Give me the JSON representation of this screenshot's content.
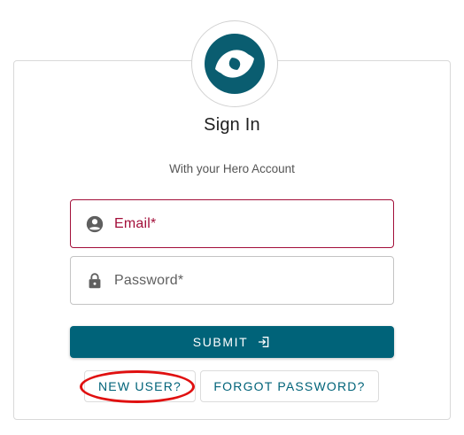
{
  "header": {
    "title": "Sign In",
    "subtitle": "With your Hero Account",
    "logo_icon": "hero-swirl-logo",
    "brand_color": "#0a5d70"
  },
  "form": {
    "email": {
      "label": "Email*",
      "icon": "account-circle-icon",
      "state": "error",
      "value": ""
    },
    "password": {
      "label": "Password*",
      "icon": "lock-icon",
      "value": ""
    },
    "submit_label": "SUBMIT",
    "submit_icon": "login-icon",
    "primary_color": "#006379",
    "error_color": "#a30f3a"
  },
  "links": {
    "new_user": "NEW USER?",
    "forgot_password": "FORGOT PASSWORD?"
  },
  "annotation": {
    "shape": "red-ellipse",
    "target": "new-user-button",
    "color": "#e01010"
  }
}
